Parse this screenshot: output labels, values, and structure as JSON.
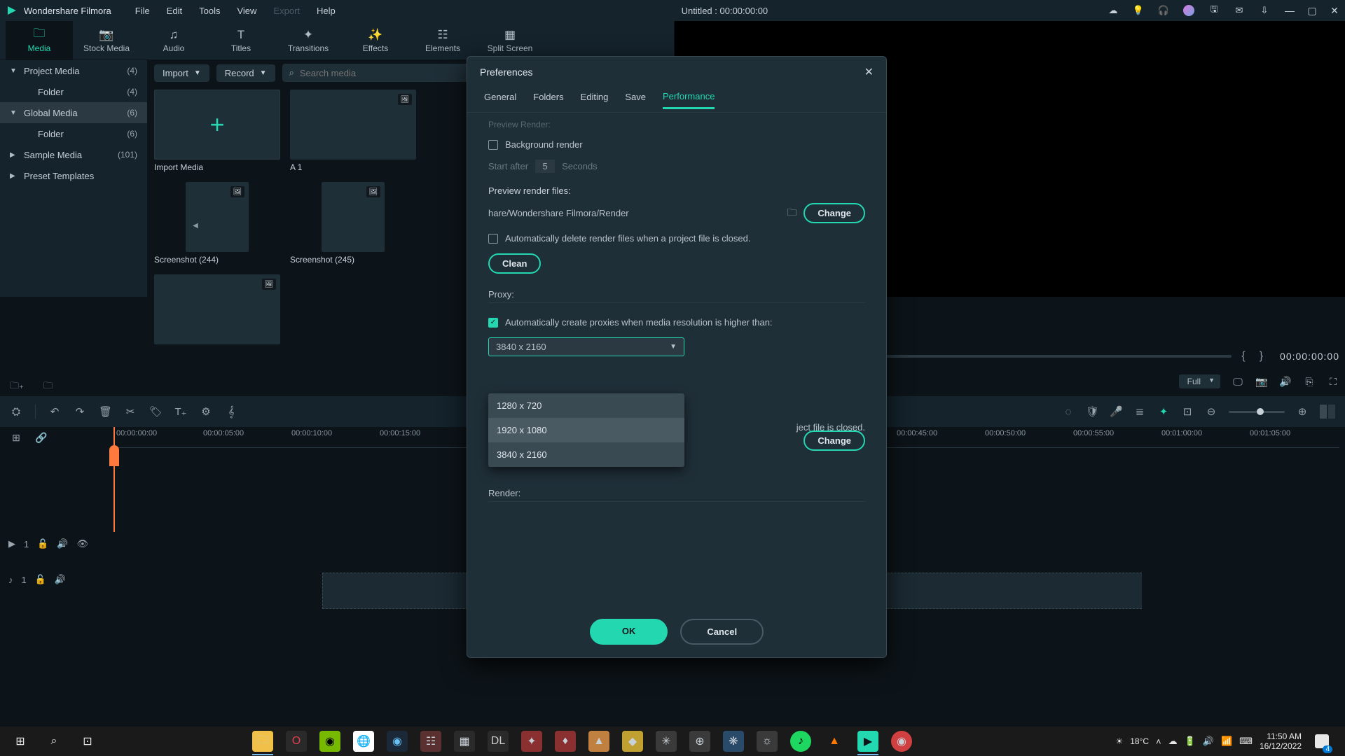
{
  "titlebar": {
    "appname": "Wondershare Filmora",
    "menus": [
      "File",
      "Edit",
      "Tools",
      "View",
      "Export",
      "Help"
    ],
    "centertitle": "Untitled : 00:00:00:00"
  },
  "maintabs": [
    {
      "label": "Media",
      "icon": "folder-icon",
      "active": true
    },
    {
      "label": "Stock Media",
      "icon": "camera-icon"
    },
    {
      "label": "Audio",
      "icon": "music-icon"
    },
    {
      "label": "Titles",
      "icon": "text-icon"
    },
    {
      "label": "Transitions",
      "icon": "transition-icon"
    },
    {
      "label": "Effects",
      "icon": "effects-icon"
    },
    {
      "label": "Elements",
      "icon": "elements-icon"
    },
    {
      "label": "Split Screen",
      "icon": "split-icon"
    }
  ],
  "export_label": "Export",
  "sidebar": {
    "items": [
      {
        "label": "Project Media",
        "count": "(4)",
        "arrow": "▼"
      },
      {
        "label": "Folder",
        "count": "(4)",
        "indent": true
      },
      {
        "label": "Global Media",
        "count": "(6)",
        "arrow": "▼",
        "selected": true
      },
      {
        "label": "Folder",
        "count": "(6)",
        "indent": true
      },
      {
        "label": "Sample Media",
        "count": "(101)",
        "arrow": "▶"
      },
      {
        "label": "Preset Templates",
        "arrow": "▶"
      }
    ]
  },
  "mediatools": {
    "import": "Import",
    "record": "Record",
    "search_placeholder": "Search media"
  },
  "thumbs": [
    {
      "cap": "Import Media",
      "type": "add"
    },
    {
      "cap": "A 1",
      "type": "sofa"
    },
    {
      "cap": "Screenshot (244)",
      "type": "street1"
    },
    {
      "cap": "Screenshot (245)",
      "type": "street2"
    },
    {
      "cap": "",
      "type": "eiffel"
    }
  ],
  "preview": {
    "timecode": "00:00:00:00",
    "zoom": "Full"
  },
  "timeline": {
    "labels": [
      "00:00:00:00",
      "00:00:05:00",
      "00:00:10:00",
      "00:00:15:00",
      "",
      "00:00:45:00",
      "00:00:50:00",
      "00:00:55:00",
      "00:01:00:00",
      "00:01:05:00"
    ]
  },
  "preferences": {
    "title": "Preferences",
    "tabs": [
      "General",
      "Folders",
      "Editing",
      "Save",
      "Performance"
    ],
    "active_tab": "Performance",
    "preview_render_label": "Preview Render:",
    "bg_render": "Background render",
    "start_after": "Start after",
    "start_val": "5",
    "seconds": "Seconds",
    "preview_files": "Preview render files:",
    "render_path": "hare/Wondershare Filmora/Render",
    "change": "Change",
    "auto_delete_render": "Automatically delete render files when a project file is closed.",
    "clean": "Clean",
    "proxy": "Proxy:",
    "auto_proxy": "Automatically create proxies when media resolution is higher than:",
    "proxy_sel": "3840 x 2160",
    "proxy_options": [
      "1280 x 720",
      "1920 x 1080",
      "3840 x 2160"
    ],
    "proxy_hover_index": 1,
    "auto_delete_proxy": "ject file is closed.",
    "render": "Render:",
    "ok": "OK",
    "cancel": "Cancel"
  },
  "tracks": {
    "video": "1",
    "audio": "1"
  },
  "taskbar": {
    "temp": "18°C",
    "time": "11:50 AM",
    "date": "16/12/2022",
    "notif_count": "4"
  }
}
